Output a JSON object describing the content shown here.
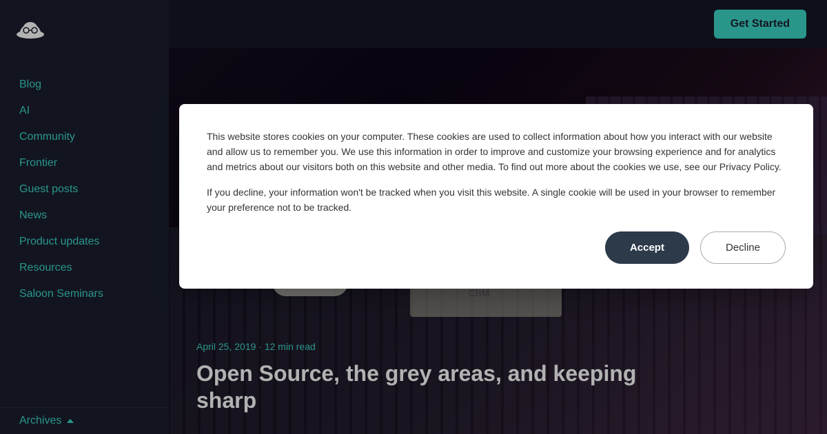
{
  "sidebar": {
    "logo_text": "O",
    "nav_items": [
      {
        "label": "Blog",
        "href": "#"
      },
      {
        "label": "AI",
        "href": "#"
      },
      {
        "label": "Community",
        "href": "#"
      },
      {
        "label": "Frontier",
        "href": "#"
      },
      {
        "label": "Guest posts",
        "href": "#"
      },
      {
        "label": "News",
        "href": "#"
      },
      {
        "label": "Product updates",
        "href": "#"
      },
      {
        "label": "Resources",
        "href": "#"
      },
      {
        "label": "Saloon Seminars",
        "href": "#"
      }
    ],
    "archives_label": "Archives",
    "archives_href": "#"
  },
  "topbar": {
    "get_started_label": "Get Started"
  },
  "hero": {
    "meta": "April 25, 2019 · 12 min read",
    "title": "Open Source, the grey areas, and keeping sharp"
  },
  "cookie": {
    "text1": "This website stores cookies on your computer. These cookies are used to collect information about how you interact with our website and allow us to remember you. We use this information in order to improve and customize your browsing experience and for analytics and metrics about our visitors both on this website and other media. To find out more about the cookies we use, see our Privacy Policy.",
    "text2": "If you decline, your information won't be tracked when you visit this website. A single cookie will be used in your browser to remember your preference not to be tracked.",
    "accept_label": "Accept",
    "decline_label": "Decline"
  }
}
